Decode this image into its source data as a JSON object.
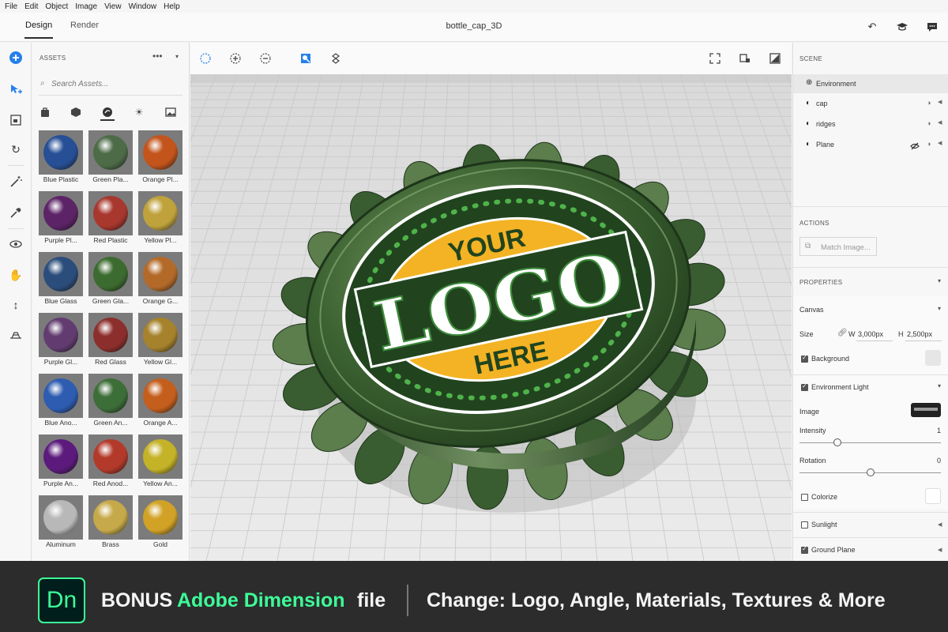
{
  "menu": [
    "File",
    "Edit",
    "Object",
    "Image",
    "View",
    "Window",
    "Help"
  ],
  "header": {
    "tabs": [
      "Design",
      "Render"
    ],
    "active_tab": "Design",
    "document_title": "bottle_cap_3D"
  },
  "assets": {
    "title": "ASSETS",
    "search_placeholder": "Search Assets...",
    "materials": [
      {
        "label": "Blue Plastic",
        "color": "#274f96"
      },
      {
        "label": "Green Pla...",
        "color": "#4d6b47"
      },
      {
        "label": "Orange Pl...",
        "color": "#c2541c"
      },
      {
        "label": "Purple Pl...",
        "color": "#5c2367"
      },
      {
        "label": "Red Plastic",
        "color": "#a8372e"
      },
      {
        "label": "Yellow Pl...",
        "color": "#bfa23c"
      },
      {
        "label": "Blue Glass",
        "color": "#2b4d7b"
      },
      {
        "label": "Green Gla...",
        "color": "#3c6b2f"
      },
      {
        "label": "Orange G...",
        "color": "#b36a29"
      },
      {
        "label": "Purple Gl...",
        "color": "#623c70"
      },
      {
        "label": "Red Glass",
        "color": "#8c2f2c"
      },
      {
        "label": "Yellow Gl...",
        "color": "#a6822c"
      },
      {
        "label": "Blue Ano...",
        "color": "#2d5cb0"
      },
      {
        "label": "Green An...",
        "color": "#3c6e38"
      },
      {
        "label": "Orange A...",
        "color": "#c45e1d"
      },
      {
        "label": "Purple An...",
        "color": "#5b1a7c"
      },
      {
        "label": "Red Anod...",
        "color": "#b33a2a"
      },
      {
        "label": "Yellow An...",
        "color": "#c4b227"
      },
      {
        "label": "Aluminum",
        "color": "#b8b8b8"
      },
      {
        "label": "Brass",
        "color": "#c6a949"
      },
      {
        "label": "Gold",
        "color": "#d1a225"
      }
    ]
  },
  "scene": {
    "title": "SCENE",
    "items": [
      {
        "label": "Environment"
      },
      {
        "label": "cap"
      },
      {
        "label": "ridges"
      },
      {
        "label": "Plane"
      }
    ]
  },
  "actions": {
    "title": "ACTIONS",
    "match_image": "Match Image..."
  },
  "properties": {
    "title": "PROPERTIES",
    "canvas_label": "Canvas",
    "size_label": "Size",
    "width_prefix": "W",
    "width": "3,000px",
    "height_prefix": "H",
    "height": "2,500px",
    "background_label": "Background",
    "background_checked": true,
    "env_light_label": "Environment Light",
    "env_light_checked": true,
    "image_label": "Image",
    "intensity_label": "Intensity",
    "intensity_value": "1",
    "rotation_label": "Rotation",
    "rotation_value": "0",
    "colorize_label": "Colorize",
    "colorize_checked": false,
    "sunlight_label": "Sunlight",
    "sunlight_checked": false,
    "ground_plane_label": "Ground Plane",
    "ground_plane_checked": true
  },
  "cap_text": {
    "top": "YOUR",
    "middle": "LOGO",
    "bottom": "HERE"
  },
  "banner": {
    "logo": "Dn",
    "bonus": "BONUS",
    "product": "Adobe Dimension",
    "file": "file",
    "change": "Change: Logo, Angle, Materials, Textures & More"
  },
  "colors": {
    "accent_blue": "#2680eb",
    "brand_green": "#3dfd98",
    "cap_green": "#3f6a36",
    "label_yellow": "#f3b324"
  }
}
